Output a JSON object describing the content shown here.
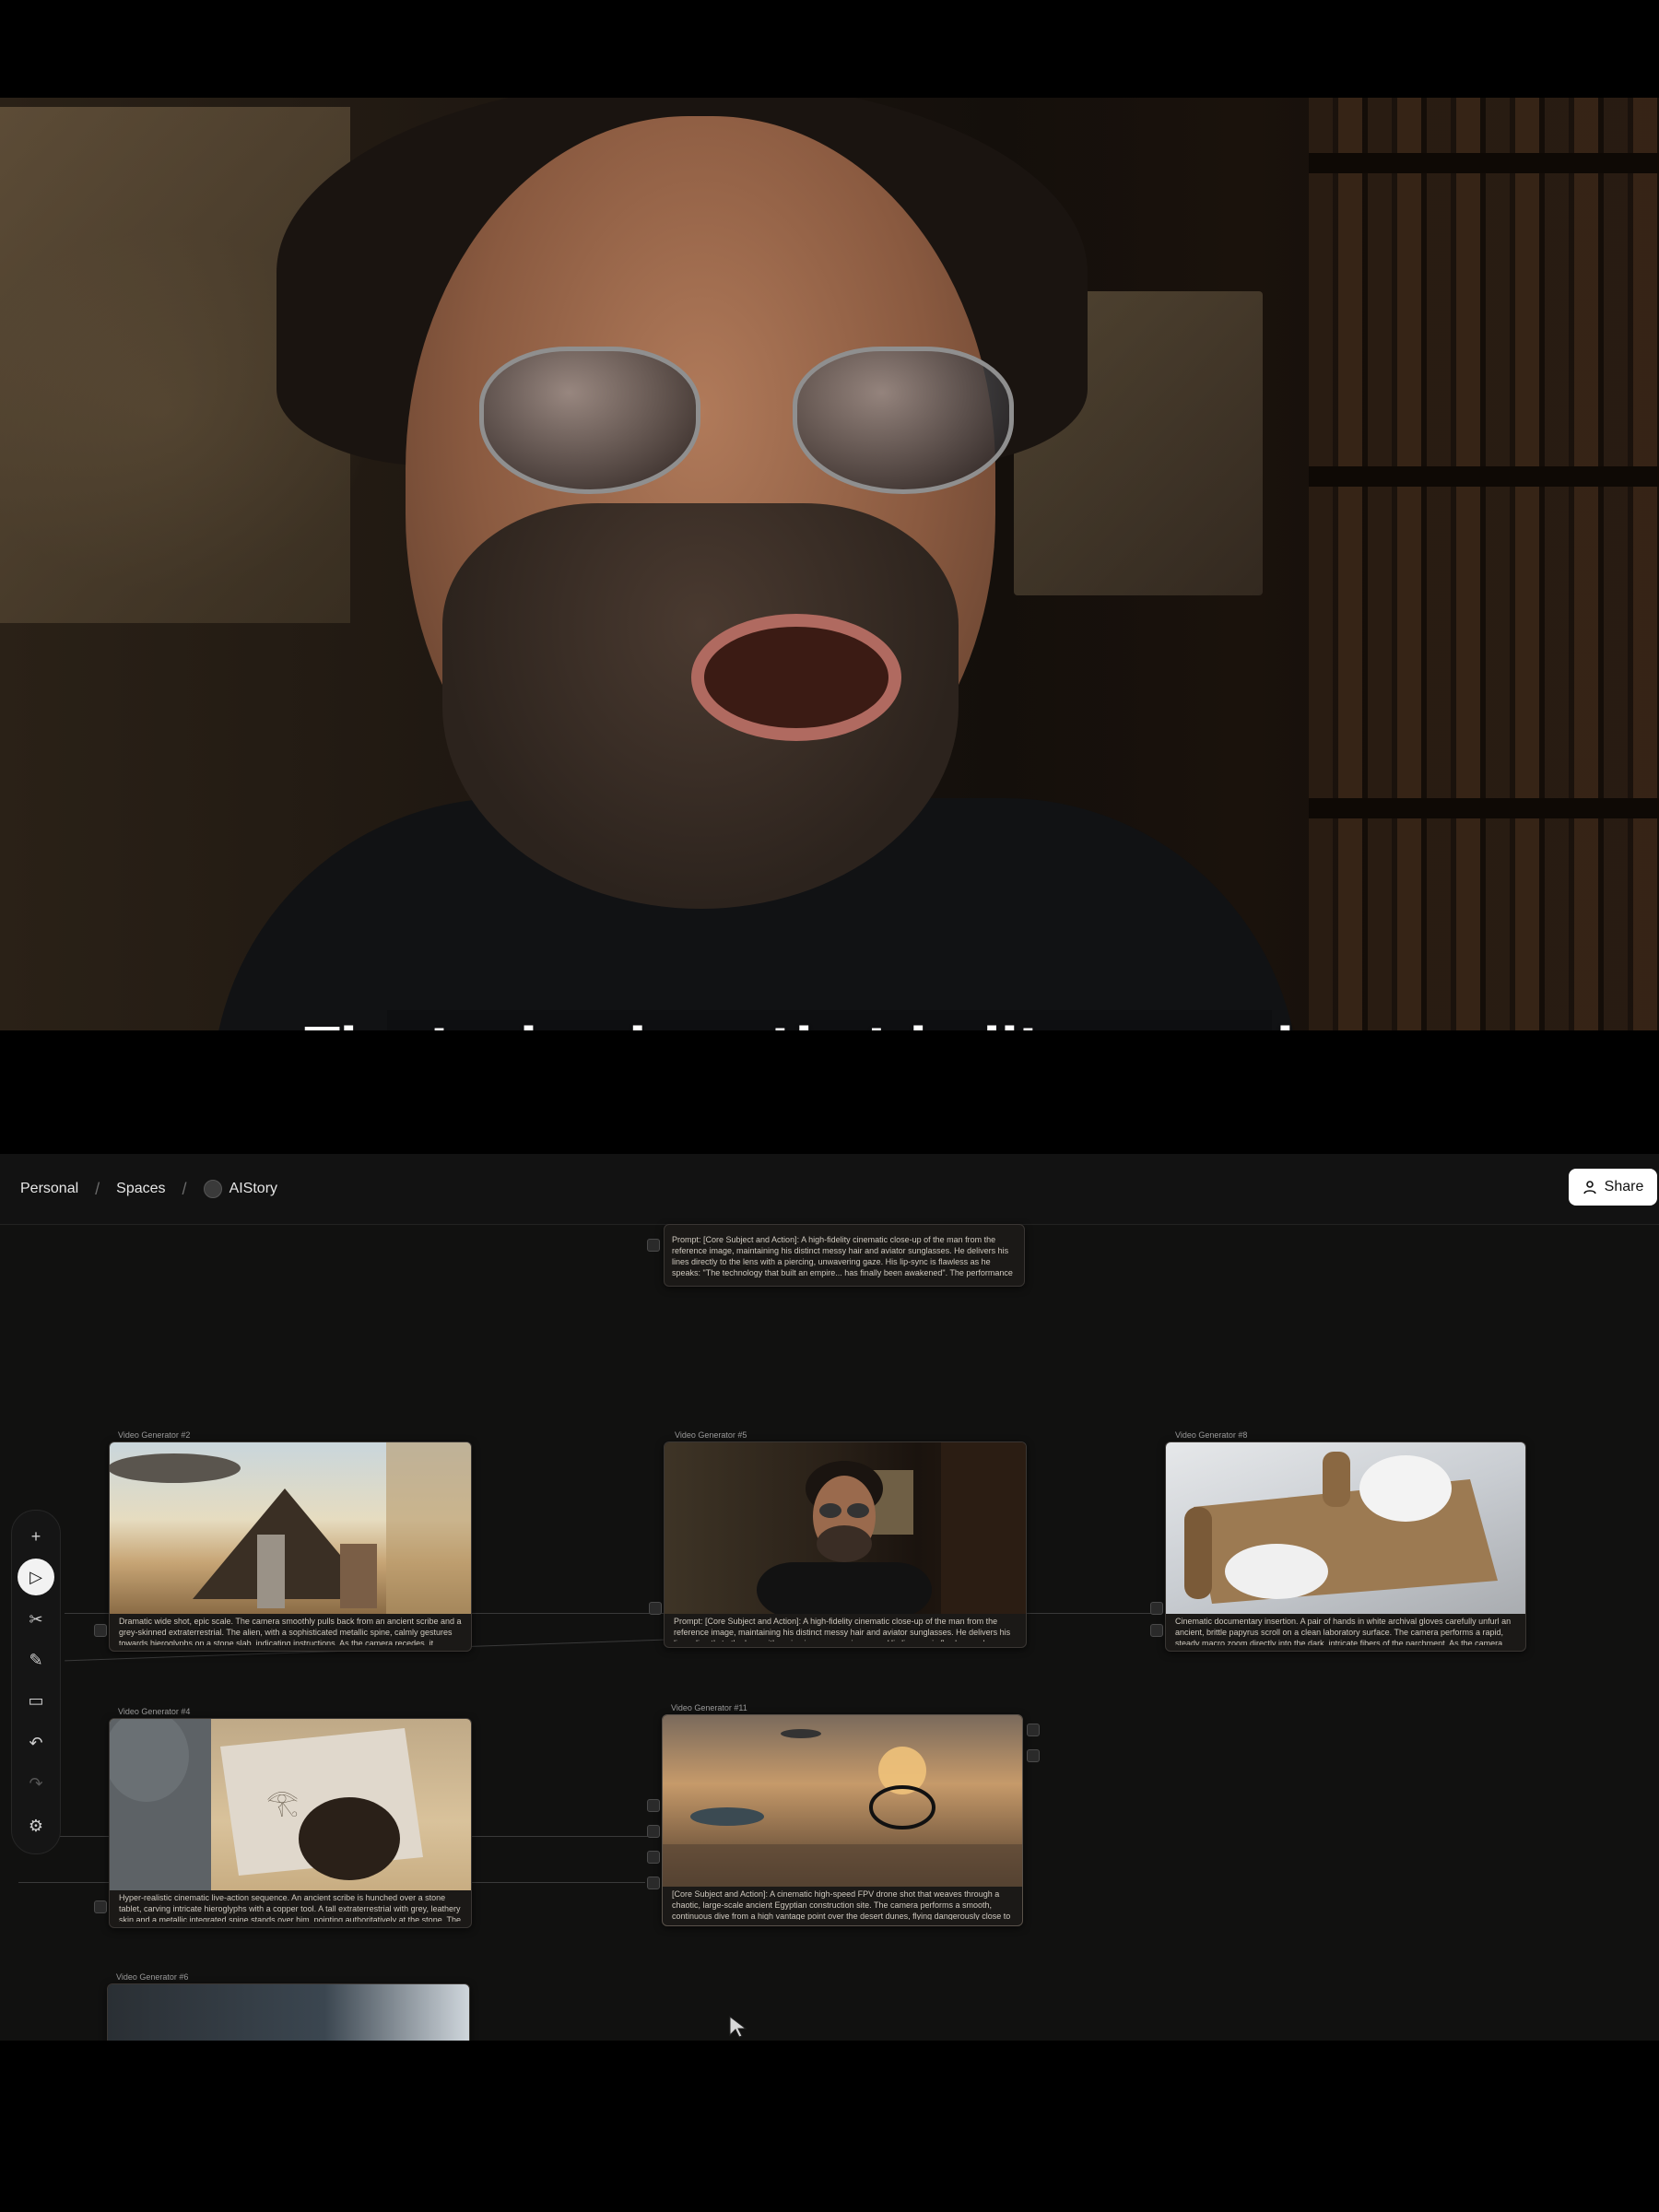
{
  "video": {
    "subtitle": "The technology that built an empire"
  },
  "topbar": {
    "breadcrumb": [
      "Personal",
      "Spaces",
      "AIStory"
    ],
    "share_label": "Share"
  },
  "toolbar": {
    "tools": [
      "add-icon",
      "play-icon",
      "scissors-icon",
      "pen-icon",
      "comment-icon",
      "undo-icon",
      "redo-icon",
      "settings-icon"
    ],
    "active_tool": "play-icon"
  },
  "nodes": {
    "top": {
      "caption": "Prompt: [Core Subject and Action]: A high-fidelity cinematic close-up of the man from the reference image, maintaining his distinct messy hair and aviator sunglasses. He delivers his lines directly to the lens with a piercing, unwavering gaze. His lip-sync is flawless as he speaks: \"The technology that built an empire... has finally been awakened\". The performance is grounded and intense, with a slight, decisive nod on the word \"awakened\"."
    },
    "n2": {
      "title": "Video Generator #2",
      "caption": "Dramatic wide shot, epic scale. The camera smoothly pulls back from an ancient scribe and a grey-skinned extraterrestrial. The alien, with a sophisticated metallic spine, calmly gestures towards hieroglyphs on a stone slab, indicating instructions. As the camera recedes, it reveals the monumental construction of a massive pyramid in the near distance, bustling with activity. Simultaneously, a colossal, sleek alien mothership looms silently and"
    },
    "n5": {
      "title": "Video Generator #5",
      "caption": "Prompt: [Core Subject and Action]: A high-fidelity cinematic close-up of the man from the reference image, maintaining his distinct messy hair and aviator sunglasses. He delivers his lines directly to the lens with a piercing, unwavering gaze. His lip-sync is flawless as he speaks: \"We have found evidence that Cleopatra made a pact with visitors from the future.\" The performance is grounded and intense, with a slight, decisive nod on the word"
    },
    "n8": {
      "title": "Video Generator #8",
      "caption": "Cinematic documentary insertion. A pair of hands in white archival gloves carefully unfurl an ancient, brittle papyrus scroll on a clean laboratory surface. The camera performs a rapid, steady macro zoom directly into the dark, intricate fibers of the parchment. As the camera \"enters\" the texture of the papyrus, the ink patterns morph into the shadows of a dark starry corridor. The transition continues..."
    },
    "n4": {
      "title": "Video Generator #4",
      "caption": "Hyper-realistic cinematic live-action sequence. An ancient scribe is hunched over a stone tablet, carving intricate hieroglyphs with a copper tool. A tall extraterrestrial with grey, leathery skin and a metallic integrated spine stands over him, pointing authoritatively at the stone. The alien suddenly executes a sharp, swift physical reprimand, its hand striking the back of the scribe's head in a sudden corrective blow. The scribe's head jerks"
    },
    "n11": {
      "title": "Video Generator #11",
      "caption": "[Core Subject and Action]: A cinematic high-speed FPV drone shot that weaves through a chaotic, large-scale ancient Egyptian construction site. The camera performs a smooth, continuous dive from a high vantage point over the desert dunes, flying dangerously close to workers hauling enormous stone blocks and sweeping over scaffolding while futuristic craft hover overhead..."
    },
    "n6": {
      "title": "Video Generator #6"
    }
  }
}
